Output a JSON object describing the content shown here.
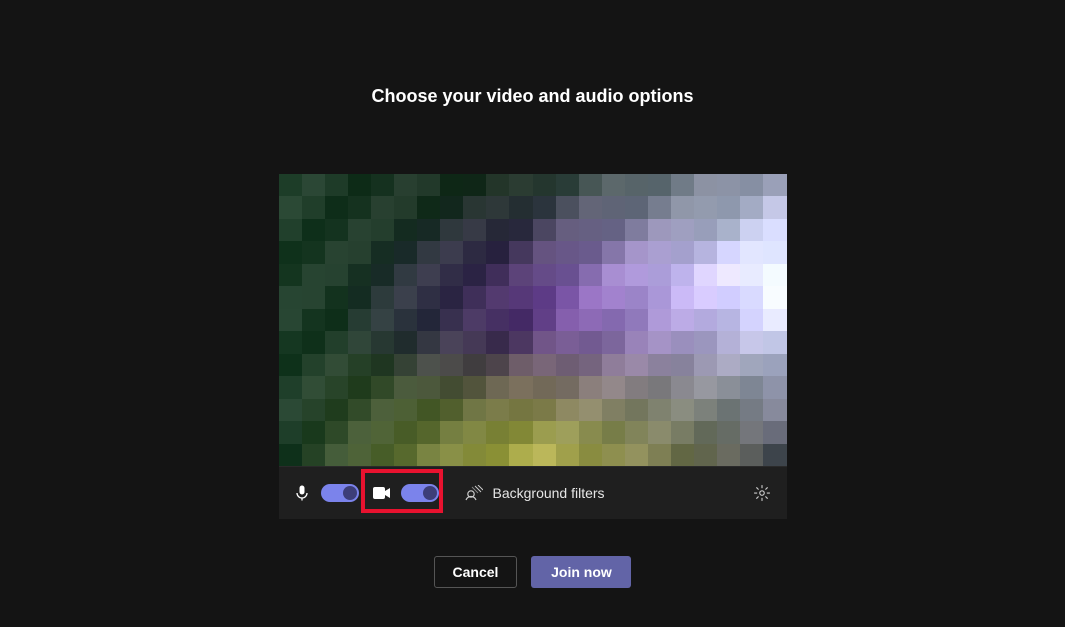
{
  "title": "Choose your video and audio options",
  "controls": {
    "mic_on": true,
    "camera_on": true,
    "bg_filters_label": "Background filters"
  },
  "buttons": {
    "cancel": "Cancel",
    "join": "Join now"
  },
  "colors": {
    "accent": "#6264a7",
    "toggle": "#7b83eb",
    "highlight": "#e8122f"
  }
}
